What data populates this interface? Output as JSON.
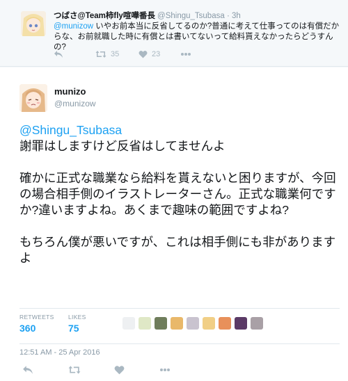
{
  "parent_tweet": {
    "display_name": "つばさ@Team柿fly喧嘩番長",
    "handle": "@Shingu_Tsubasa",
    "separator": "·",
    "time": "3h",
    "mention": "@munizow",
    "text": " いやお前本当に反省してるのか?普通に考えて仕事ってのは有償だからな、お前就職した時に有償とは書いてないって給料貰えなかったらどうすんの?",
    "retweets": "35",
    "likes": "23",
    "icons": [
      "reply-icon",
      "retweet-icon",
      "like-icon",
      "more-icon"
    ]
  },
  "main_tweet": {
    "display_name": "munizo",
    "handle": "@munizow",
    "mention": "@Shingu_Tsubasa",
    "body": "謝罪はしますけど反省はしてませんよ\n\n確かに正式な職業なら給料を貰えないと困りますが、今回の場合相手側のイラストレーターさん。正式な職業何ですか?違いますよね。あくまで趣味の範囲ですよね?\n\nもちろん僕が悪いですが、これは相手側にも非がありますよ",
    "stats": {
      "retweets_label": "RETWEETS",
      "retweets_count": "360",
      "likes_label": "LIKES",
      "likes_count": "75"
    },
    "timestamp": "12:51 AM - 25 Apr 2016",
    "liker_avatar_colors": [
      "#eef0f2",
      "#dfe8c6",
      "#6f7d5b",
      "#e9b86a",
      "#c9c3cf",
      "#f1cf86",
      "#e8905a",
      "#5b3a66",
      "#a9a0a6"
    ],
    "icons": [
      "reply-icon",
      "retweet-icon",
      "like-icon",
      "more-icon"
    ]
  },
  "colors": {
    "accent": "#1da1f2",
    "muted": "#8899a6",
    "icon": "#aab8c2",
    "text": "#14171a"
  }
}
